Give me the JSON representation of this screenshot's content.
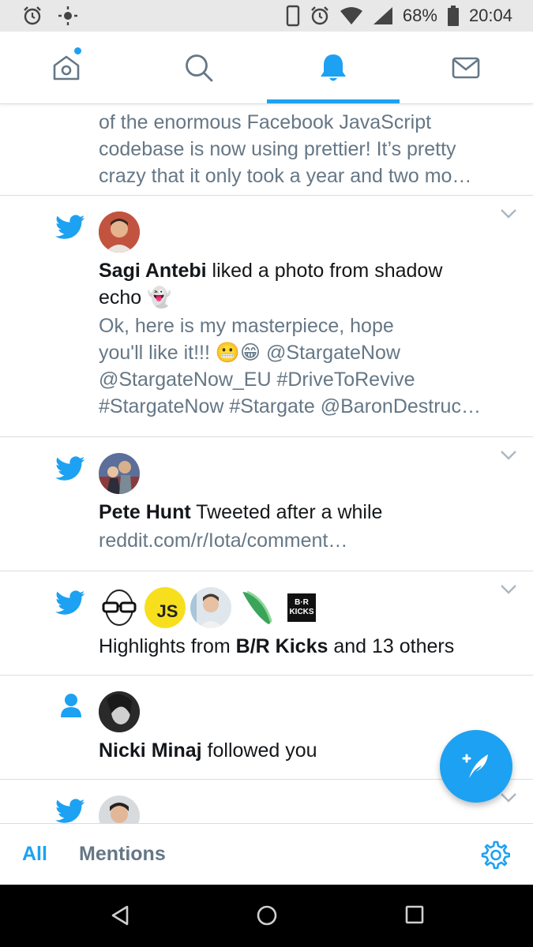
{
  "status_bar": {
    "battery_percent": "68%",
    "time": "20:04"
  },
  "top_nav": {
    "tabs": [
      {
        "icon": "home-icon",
        "selected": false,
        "has_dot": true
      },
      {
        "icon": "search-icon",
        "selected": false
      },
      {
        "icon": "bell-icon",
        "selected": true
      },
      {
        "icon": "mail-icon",
        "selected": false
      }
    ],
    "accent_color": "#1da1f2"
  },
  "feed": {
    "partial_top": {
      "lines": [
        "of the enormous Facebook JavaScript",
        "codebase is now using prettier! It’s pretty",
        "crazy that it only took a year and two mo…"
      ]
    },
    "items": [
      {
        "type": "like",
        "name": "Sagi Antebi",
        "action_line1": " liked a photo from shadow",
        "action_line2": "echo 👻",
        "tweet_lines": [
          "Ok, here is my masterpiece, hope",
          "you'll like it!!! 😬😁 @StargateNow",
          "@StargateNow_EU #DriveToRevive",
          "#StargateNow #Stargate @BaronDestruc…"
        ]
      },
      {
        "type": "tweet",
        "name": "Pete Hunt",
        "action": " Tweeted after a while",
        "link": "reddit.com/r/Iota/comment…"
      },
      {
        "type": "highlights",
        "prefix": "Highlights from ",
        "name": "B/R Kicks",
        "suffix": " and 13 others",
        "avatars": [
          "JS",
          "B·R KICKS"
        ]
      },
      {
        "type": "follow",
        "name": "Nicki Minaj",
        "action": " followed you"
      }
    ]
  },
  "bottom_bar": {
    "filters": [
      "All",
      "Mentions"
    ],
    "active_filter": "All"
  }
}
